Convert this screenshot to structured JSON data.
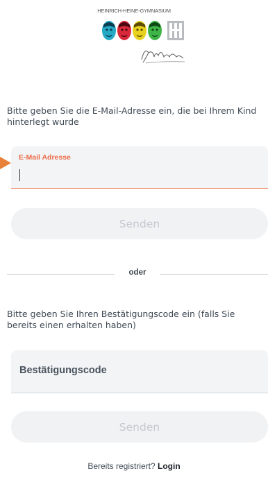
{
  "header": {
    "school_name": "HEINRICH-HEINE-GYMNASIUM",
    "logo_icon": "school-portraits-logo-icon",
    "signature_icon": "heine-signature-icon"
  },
  "email_section": {
    "description": "Bitte geben Sie die E-Mail-Adresse ein, die bei Ihrem Kind hinterlegt wurde",
    "field_label": "E-Mail Adresse",
    "field_value": "",
    "accent_color": "#ee6b47",
    "send_label": "Senden"
  },
  "divider": {
    "label": "oder"
  },
  "code_section": {
    "description": "Bitte geben Sie Ihren Bestätigungscode ein (falls Sie bereits einen erhalten haben)",
    "field_placeholder": "Bestätigungscode",
    "send_label": "Senden"
  },
  "footer": {
    "prompt": "Bereits registriert?",
    "login_label": "Login"
  },
  "colors": {
    "arrow": "#e8823a",
    "button_bg": "#f0f2f4",
    "button_text_disabled": "#c4c9ce",
    "field_bg": "#f2f4f6"
  }
}
